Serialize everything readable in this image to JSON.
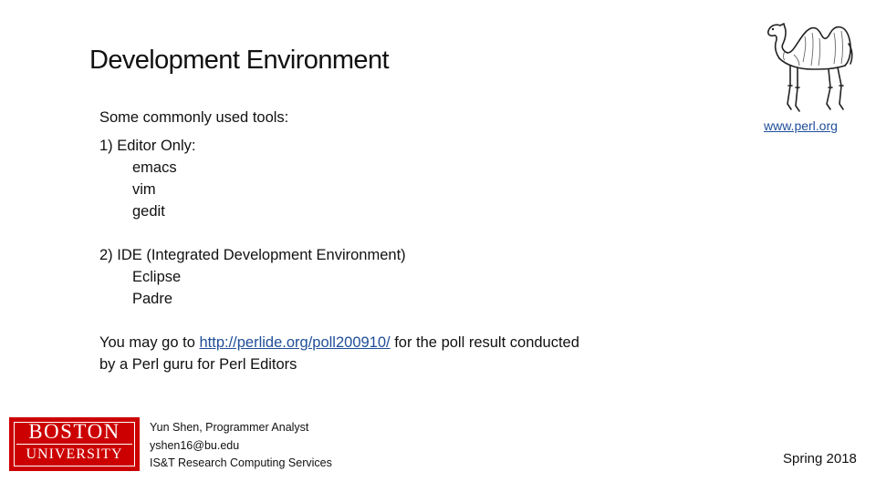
{
  "slide": {
    "title": "Development Environment",
    "intro": "Some commonly used tools:",
    "section1": {
      "heading": "1) Editor Only:",
      "items": [
        "emacs",
        "vim",
        "gedit"
      ]
    },
    "section2": {
      "heading": "2) IDE (Integrated Development Environment)",
      "items": [
        "Eclipse",
        "Padre"
      ]
    },
    "note": {
      "prefix": "You may go to ",
      "link_text": "http://perlide.org/poll200910/",
      "suffix": " for the poll result conducted",
      "line2": "by a Perl guru for Perl Editors"
    },
    "perl_link": "www.perl.org"
  },
  "footer": {
    "logo": {
      "line1": "BOSTON",
      "line2": "UNIVERSITY",
      "color": "#cc0000"
    },
    "author_name": "Yun Shen, Programmer Analyst",
    "author_email": "yshen16@bu.edu",
    "author_org": "IS&T Research Computing Services",
    "semester": "Spring 2018"
  },
  "icons": {
    "camel": "perl-camel-icon"
  },
  "colors": {
    "link": "#1f4e99",
    "brand": "#cc0000"
  }
}
